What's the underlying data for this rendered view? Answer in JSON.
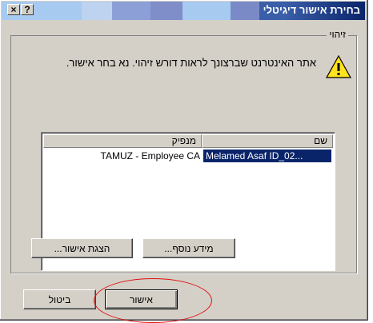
{
  "window": {
    "title": "בחירת אישור דיגיטלי",
    "help_button": "?",
    "close_button": "×"
  },
  "identity_group": {
    "label": "זיהוי",
    "icon": "warning-icon",
    "message": "אתר האינטרנט שברצונך לראות דורש זיהוי. נא בחר אישור."
  },
  "cert_list": {
    "columns": {
      "name": "שם",
      "issuer": "מנפיק"
    },
    "rows": [
      {
        "name": "Melamed Asaf ID_02...",
        "issuer": "TAMUZ - Employee CA",
        "selected": true
      }
    ]
  },
  "buttons": {
    "more_info": "מידע נוסף...",
    "view_cert": "הצגת אישור...",
    "ok": "אישור",
    "cancel": "ביטול"
  },
  "colors": {
    "title_gradient_dark": "#0a246a",
    "title_gradient_light": "#a6caf0",
    "selection": "#0a246a",
    "annotation_circle": "#e01010"
  }
}
